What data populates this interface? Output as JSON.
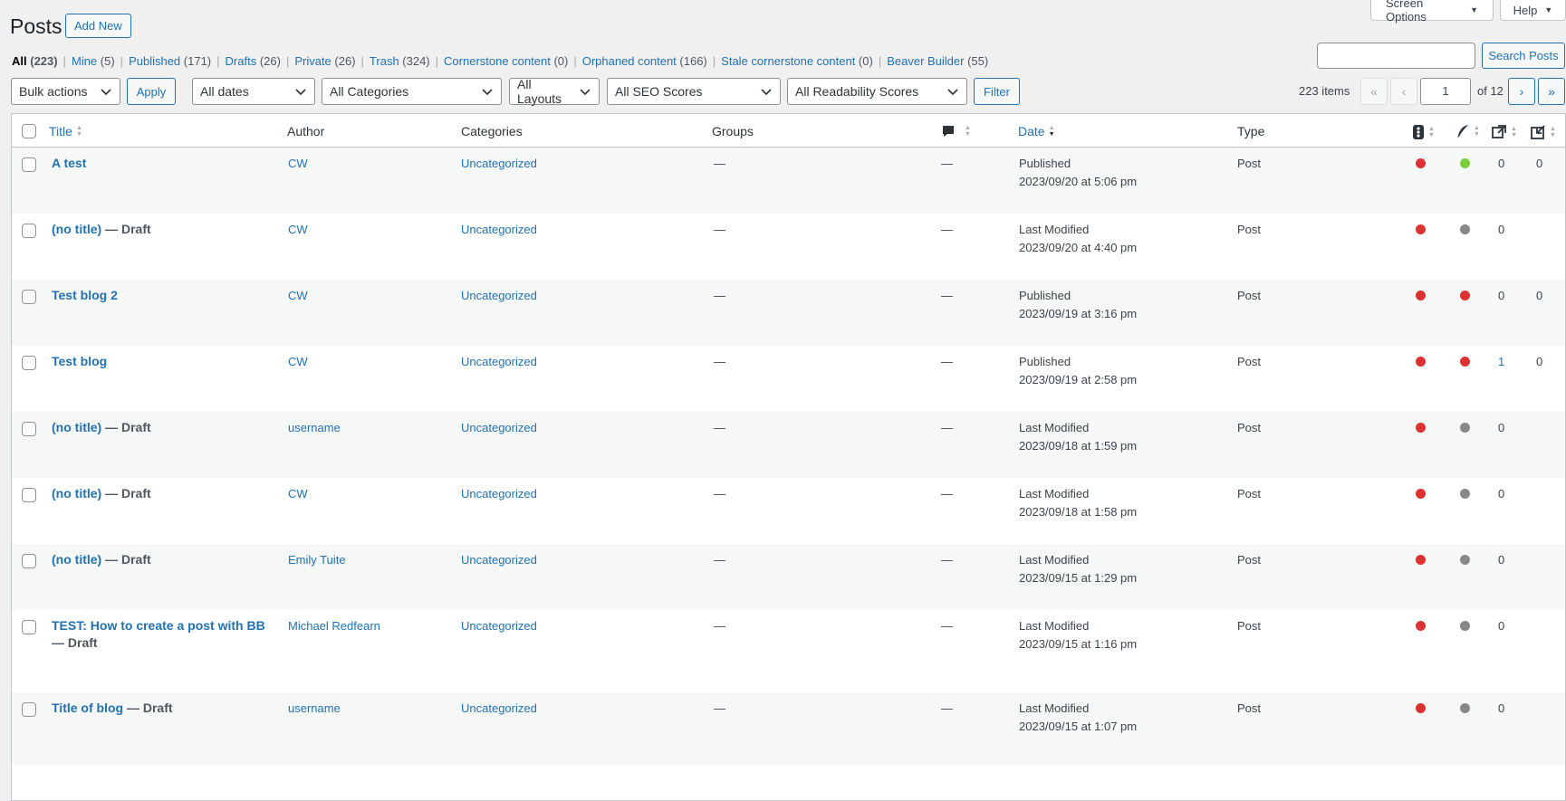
{
  "header": {
    "title": "Posts",
    "add_new": "Add New",
    "screen_options": "Screen Options",
    "help": "Help"
  },
  "views": [
    {
      "label": "All",
      "count": "(223)",
      "current": true
    },
    {
      "label": "Mine",
      "count": "(5)"
    },
    {
      "label": "Published",
      "count": "(171)"
    },
    {
      "label": "Drafts",
      "count": "(26)"
    },
    {
      "label": "Private",
      "count": "(26)"
    },
    {
      "label": "Trash",
      "count": "(324)"
    },
    {
      "label": "Cornerstone content",
      "count": "(0)"
    },
    {
      "label": "Orphaned content",
      "count": "(166)"
    },
    {
      "label": "Stale cornerstone content",
      "count": "(0)"
    },
    {
      "label": "Beaver Builder",
      "count": "(55)"
    }
  ],
  "search": {
    "button": "Search Posts",
    "value": ""
  },
  "filters": {
    "bulk_actions": "Bulk actions",
    "apply": "Apply",
    "dates": "All dates",
    "categories": "All Categories",
    "layouts": "All Layouts",
    "seo": "All SEO Scores",
    "readability": "All Readability Scores",
    "filter": "Filter"
  },
  "pagination": {
    "items": "223 items",
    "first": "«",
    "prev": "‹",
    "current": "1",
    "of": "of 12",
    "next": "›",
    "last": "»"
  },
  "columns": {
    "title": "Title",
    "author": "Author",
    "categories": "Categories",
    "groups": "Groups",
    "date": "Date",
    "type": "Type"
  },
  "icons": {
    "comments": "comment-bubble-icon",
    "seo": "traffic-light-icon",
    "readability": "quill-icon",
    "outgoing_links": "outgoing-links-icon",
    "incoming_links": "incoming-links-icon"
  },
  "colors": {
    "seo_bad": "#dc3232",
    "seo_good": "#7ad03a",
    "seo_na": "#888888",
    "link": "#2271b1"
  },
  "rows": [
    {
      "title": "A test",
      "state": "",
      "author": "CW",
      "category": "Uncategorized",
      "groups": "—",
      "comments": "—",
      "date_status": "Published",
      "date": "2023/09/20 at 5:06 pm",
      "type": "Post",
      "seo": "red",
      "readability": "green",
      "links_out": "0",
      "links_in": "0",
      "links_out_link": false
    },
    {
      "title": "(no title)",
      "state": " — Draft",
      "author": "CW",
      "category": "Uncategorized",
      "groups": "—",
      "comments": "—",
      "date_status": "Last Modified",
      "date": "2023/09/20 at 4:40 pm",
      "type": "Post",
      "seo": "red",
      "readability": "gray",
      "links_out": "0",
      "links_in": "",
      "links_out_link": false
    },
    {
      "title": "Test blog 2",
      "state": "",
      "author": "CW",
      "category": "Uncategorized",
      "groups": "—",
      "comments": "—",
      "date_status": "Published",
      "date": "2023/09/19 at 3:16 pm",
      "type": "Post",
      "seo": "red",
      "readability": "red",
      "links_out": "0",
      "links_in": "0",
      "links_out_link": false
    },
    {
      "title": "Test blog",
      "state": "",
      "author": "CW",
      "category": "Uncategorized",
      "groups": "—",
      "comments": "—",
      "date_status": "Published",
      "date": "2023/09/19 at 2:58 pm",
      "type": "Post",
      "seo": "red",
      "readability": "red",
      "links_out": "1",
      "links_in": "0",
      "links_out_link": true
    },
    {
      "title": "(no title)",
      "state": " — Draft",
      "author": "username",
      "category": "Uncategorized",
      "groups": "—",
      "comments": "—",
      "date_status": "Last Modified",
      "date": "2023/09/18 at 1:59 pm",
      "type": "Post",
      "seo": "red",
      "readability": "gray",
      "links_out": "0",
      "links_in": "",
      "links_out_link": false
    },
    {
      "title": "(no title)",
      "state": " — Draft",
      "author": "CW",
      "category": "Uncategorized",
      "groups": "—",
      "comments": "—",
      "date_status": "Last Modified",
      "date": "2023/09/18 at 1:58 pm",
      "type": "Post",
      "seo": "red",
      "readability": "gray",
      "links_out": "0",
      "links_in": "",
      "links_out_link": false
    },
    {
      "title": "(no title)",
      "state": " — Draft",
      "author": "Emily Tuite",
      "category": "Uncategorized",
      "groups": "—",
      "comments": "—",
      "date_status": "Last Modified",
      "date": "2023/09/15 at 1:29 pm",
      "type": "Post",
      "seo": "red",
      "readability": "gray",
      "links_out": "0",
      "links_in": "",
      "links_out_link": false
    },
    {
      "title": "TEST: How to create a post with BB",
      "state": " — Draft",
      "author": "Michael Redfearn",
      "category": "Uncategorized",
      "groups": "—",
      "comments": "—",
      "date_status": "Last Modified",
      "date": "2023/09/15 at 1:16 pm",
      "type": "Post",
      "seo": "red",
      "readability": "gray",
      "links_out": "0",
      "links_in": "",
      "links_out_link": false
    },
    {
      "title": "Title of blog",
      "state": " — Draft",
      "author": "username",
      "category": "Uncategorized",
      "groups": "—",
      "comments": "—",
      "date_status": "Last Modified",
      "date": "2023/09/15 at 1:07 pm",
      "type": "Post",
      "seo": "red",
      "readability": "gray",
      "links_out": "0",
      "links_in": "",
      "links_out_link": false
    }
  ]
}
